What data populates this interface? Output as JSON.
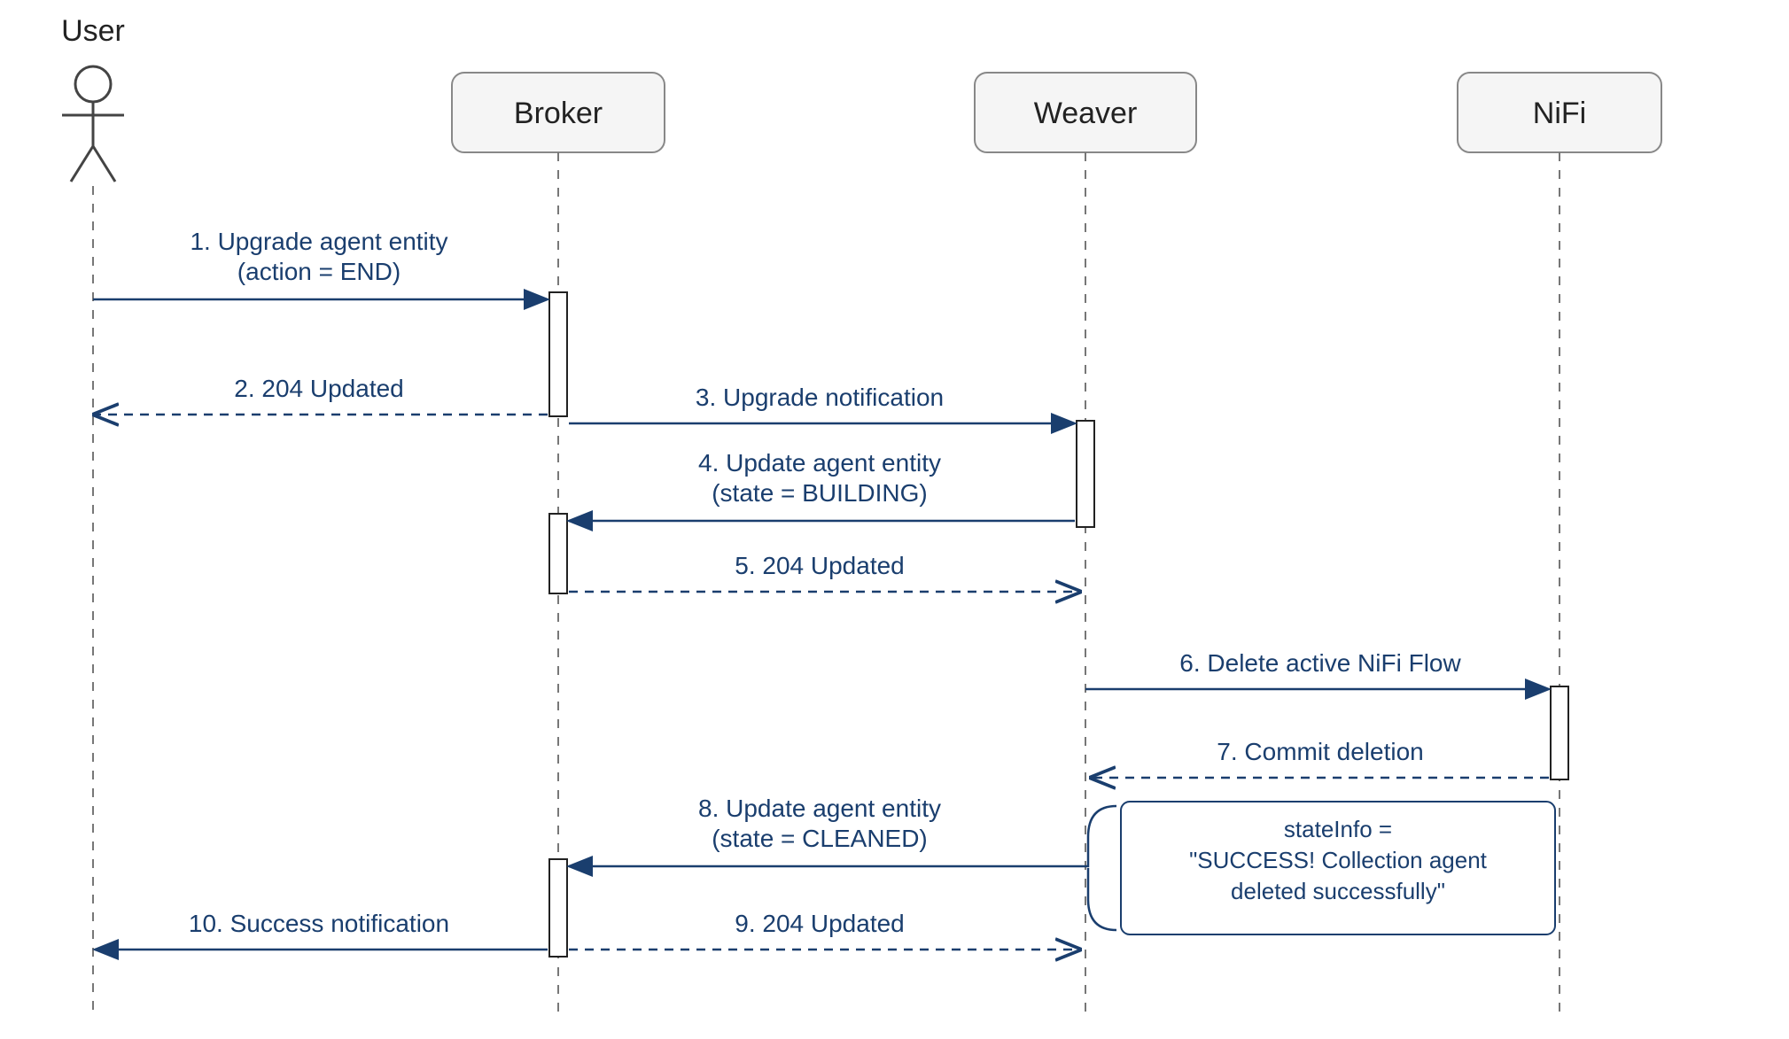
{
  "participants": {
    "user": {
      "label": "User"
    },
    "broker": {
      "label": "Broker"
    },
    "weaver": {
      "label": "Weaver"
    },
    "nifi": {
      "label": "NiFi"
    }
  },
  "messages": {
    "m1_l1": "1. Upgrade agent entity",
    "m1_l2": "(action = END)",
    "m2": "2. 204 Updated",
    "m3": "3. Upgrade notification",
    "m4_l1": "4. Update agent entity",
    "m4_l2": "(state = BUILDING)",
    "m5": "5. 204 Updated",
    "m6": "6. Delete active NiFi Flow",
    "m7": "7. Commit deletion",
    "m8_l1": "8. Update agent entity",
    "m8_l2": "(state = CLEANED)",
    "m9": "9. 204 Updated",
    "m10": "10. Success notification"
  },
  "note": {
    "l1": "stateInfo =",
    "l2": "\"SUCCESS! Collection agent",
    "l3": "deleted successfully\""
  }
}
